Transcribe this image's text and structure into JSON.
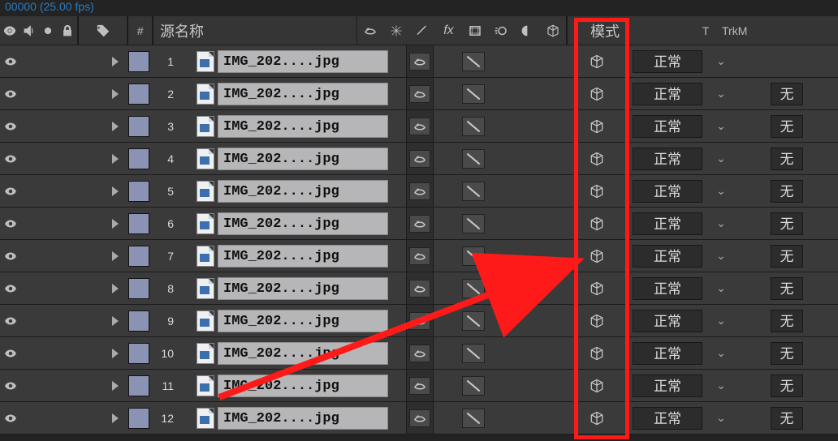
{
  "timecode": "00000 (25.00 fps)",
  "header": {
    "source_name": "源名称",
    "mode": "模式",
    "t": "T",
    "trk": "TrkM",
    "num_symbol": "#"
  },
  "blend_mode_default": "正常",
  "track_matte_default": "无",
  "layers": [
    {
      "index": 1,
      "name": "IMG_202....jpg",
      "mode": "正常",
      "trk": ""
    },
    {
      "index": 2,
      "name": "IMG_202....jpg",
      "mode": "正常",
      "trk": "无"
    },
    {
      "index": 3,
      "name": "IMG_202....jpg",
      "mode": "正常",
      "trk": "无"
    },
    {
      "index": 4,
      "name": "IMG_202....jpg",
      "mode": "正常",
      "trk": "无"
    },
    {
      "index": 5,
      "name": "IMG_202....jpg",
      "mode": "正常",
      "trk": "无"
    },
    {
      "index": 6,
      "name": "IMG_202....jpg",
      "mode": "正常",
      "trk": "无"
    },
    {
      "index": 7,
      "name": "IMG_202....jpg",
      "mode": "正常",
      "trk": "无"
    },
    {
      "index": 8,
      "name": "IMG_202....jpg",
      "mode": "正常",
      "trk": "无"
    },
    {
      "index": 9,
      "name": "IMG_202....jpg",
      "mode": "正常",
      "trk": "无"
    },
    {
      "index": 10,
      "name": "IMG_202....jpg",
      "mode": "正常",
      "trk": "无"
    },
    {
      "index": 11,
      "name": "IMG_202....jpg",
      "mode": "正常",
      "trk": "无"
    },
    {
      "index": 12,
      "name": "IMG_202....jpg",
      "mode": "正常",
      "trk": "无"
    }
  ],
  "highlight": {
    "column": "3d-layer-switch"
  }
}
